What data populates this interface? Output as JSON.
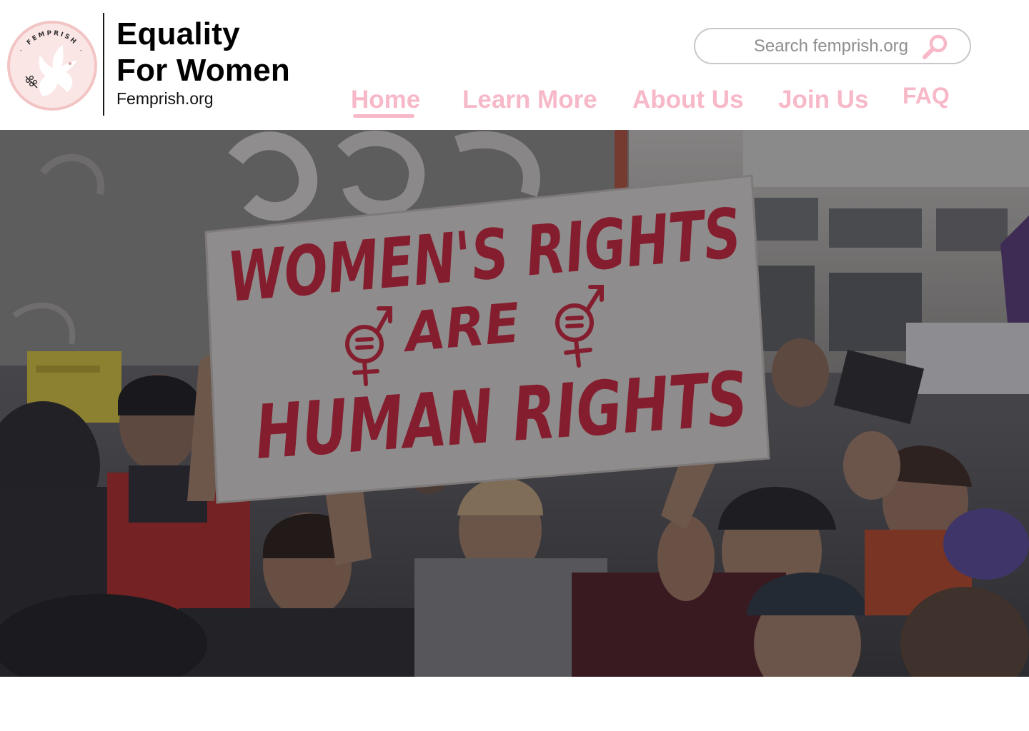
{
  "brand": {
    "title": "Equality\nFor Women",
    "domain": "Femprish.org",
    "logo_text": "FEMPRISH",
    "logo_icon": "dove-icon",
    "colors": {
      "accent": "#f7b8c8",
      "logo_bg": "#fbe3e3",
      "logo_ring": "#f1bcbc"
    }
  },
  "search": {
    "placeholder": "Search femprish.org",
    "icon": "search-icon"
  },
  "nav": {
    "items": [
      {
        "label": "Home",
        "active": true
      },
      {
        "label": "Learn More",
        "active": false
      },
      {
        "label": "About Us",
        "active": false
      },
      {
        "label": "Join Us",
        "active": false
      },
      {
        "label": "FAQ",
        "active": false
      }
    ]
  },
  "hero": {
    "sign_line1": "WOMEN'S RIGHTS",
    "sign_line2": "ARE",
    "sign_line3": "HUMAN RIGHTS",
    "sign_color": "#c8243a"
  }
}
